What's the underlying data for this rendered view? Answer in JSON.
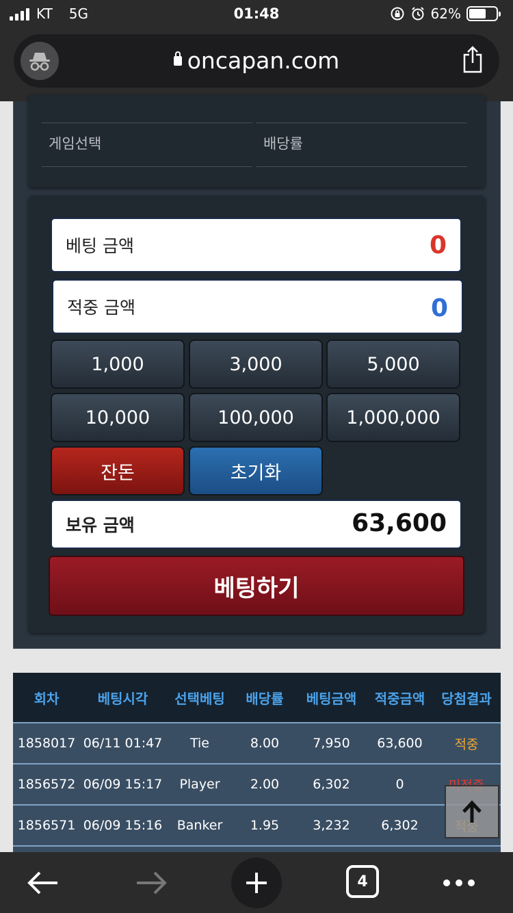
{
  "status": {
    "carrier": "KT",
    "network": "5G",
    "time": "01:48",
    "battery": "62%"
  },
  "browser": {
    "url": "oncapan.com",
    "tab_count": "4"
  },
  "info": {
    "row_game": "게임선택",
    "row_odds": "배당률"
  },
  "bet": {
    "bet_amount_label": "베팅 금액",
    "bet_amount_value": "0",
    "win_amount_label": "적중 금액",
    "win_amount_value": "0",
    "chips": [
      "1,000",
      "3,000",
      "5,000",
      "10,000",
      "100,000",
      "1,000,000"
    ],
    "balance_btn": "잔돈",
    "reset_btn": "초기화",
    "held_label": "보유 금액",
    "held_value": "63,600",
    "submit": "베팅하기"
  },
  "table": {
    "headers": [
      "회차",
      "베팅시각",
      "선택베팅",
      "배당률",
      "베팅금액",
      "적중금액",
      "당첨결과"
    ],
    "rows": [
      [
        "1858017",
        "06/11 01:47",
        "Tie",
        "8.00",
        "7,950",
        "63,600",
        "적중"
      ],
      [
        "1856572",
        "06/09 15:17",
        "Player",
        "2.00",
        "6,302",
        "0",
        "미적중"
      ],
      [
        "1856571",
        "06/09 15:16",
        "Banker",
        "1.95",
        "3,232",
        "6,302",
        "적중"
      ]
    ]
  },
  "colors": {
    "bet_value": "#d9362b",
    "win_value": "#2f6fd6",
    "header_text": "#4ba2ea"
  }
}
